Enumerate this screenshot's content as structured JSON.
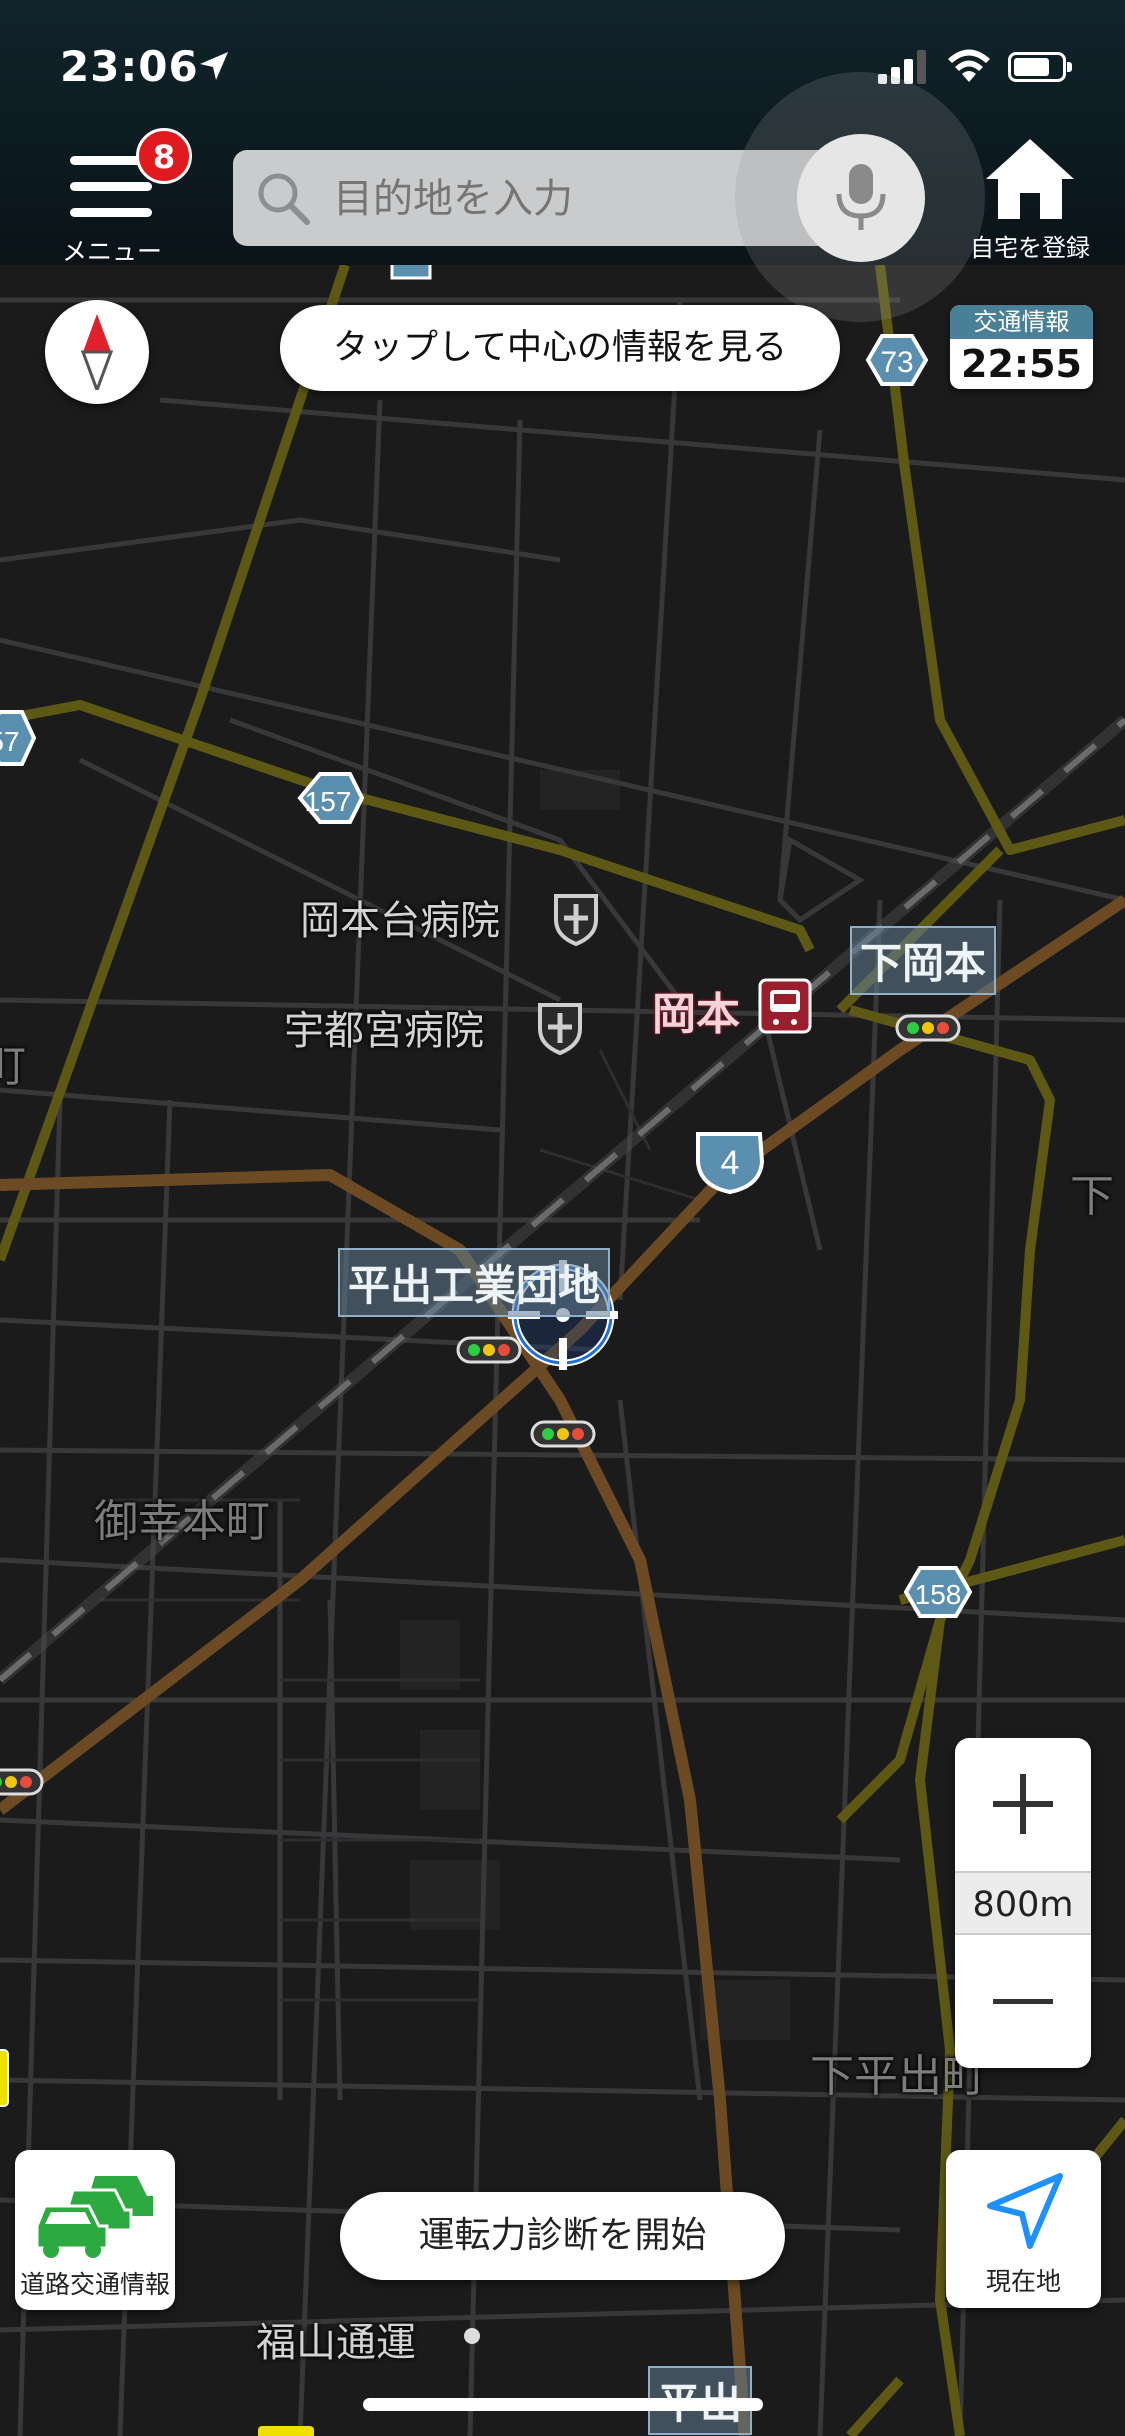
{
  "status_bar": {
    "time": "23:06",
    "icons": [
      "location-arrow-icon",
      "signal-icon",
      "wifi-icon",
      "battery-icon"
    ]
  },
  "header": {
    "menu_label": "メニュー",
    "menu_badge": "8",
    "search_placeholder": "目的地を入力",
    "home_label": "自宅を登録"
  },
  "map_controls": {
    "center_info_label": "タップして中心の情報を見る",
    "traffic_info_title": "交通情報",
    "traffic_info_time": "22:55",
    "zoom_scale": "800m",
    "road_traffic_label": "道路交通情報",
    "drive_diagnosis_label": "運転力診断を開始",
    "current_location_label": "現在地"
  },
  "map": {
    "labels": {
      "hospital_okamotodai": "岡本台病院",
      "hospital_utsunomiya": "宇都宮病院",
      "station_okamoto": "岡本",
      "area_shimookamoto": "下岡本",
      "area_hiraide_industrial": "平出工業団地",
      "area_migoko": "御幸本町",
      "area_shimohiraide": "下平出町",
      "poi_fukuyama": "福山通運",
      "area_hiraide": "平出",
      "area_edge_right": "下",
      "area_edge_left": "町"
    },
    "route_numbers": {
      "r157": "157",
      "r157_edge": "57",
      "r73": "73",
      "r4": "4",
      "r158": "158"
    },
    "colors": {
      "background": "#1b1b1c",
      "minor_road": "#3a3a3c",
      "prefectural_road": "#5e5a14",
      "national_road": "#6a4a24",
      "railway": "#8a8a8a",
      "route_shield": "#5a8fb0",
      "station": "#9b1e2d",
      "accent_blue": "#1e90ff"
    }
  }
}
